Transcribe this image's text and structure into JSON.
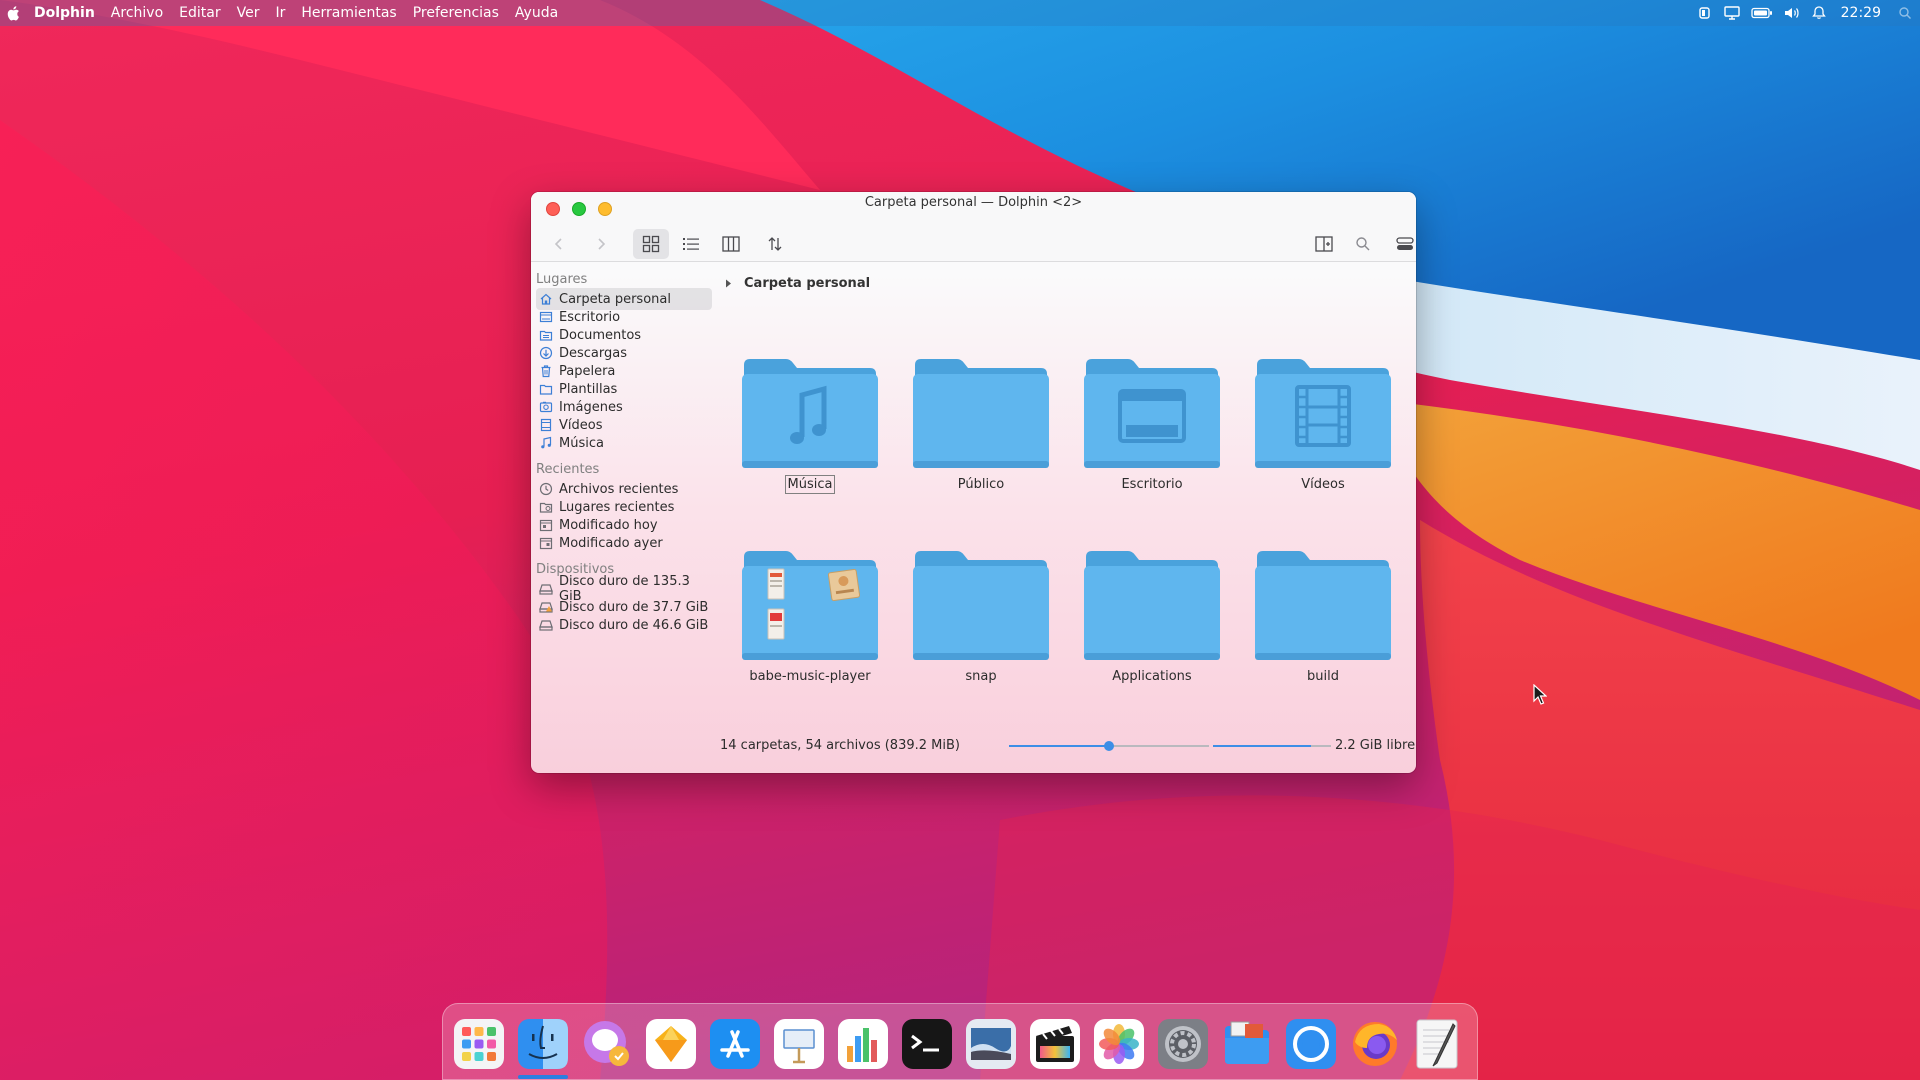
{
  "menubar": {
    "app_name": "Dolphin",
    "items": [
      "Archivo",
      "Editar",
      "Ver",
      "Ir",
      "Herramientas",
      "Preferencias",
      "Ayuda"
    ],
    "tray_icons": [
      "battery-monitor-icon",
      "display-icon",
      "battery-icon",
      "volume-icon",
      "notifications-icon"
    ],
    "clock": "22:29"
  },
  "window": {
    "title": "Carpeta personal — Dolphin <2>",
    "toolbar": {
      "buttons": [
        "back-icon",
        "forward-icon",
        "icons-view-icon",
        "details-view-icon",
        "columns-view-icon",
        "sort-icon",
        "split-view-icon",
        "search-icon",
        "menu-icon"
      ],
      "active_view": "icons"
    },
    "sidebar": {
      "sections": [
        {
          "title": "Lugares",
          "items": [
            {
              "label": "Carpeta personal",
              "icon": "home-icon",
              "selected": true
            },
            {
              "label": "Escritorio",
              "icon": "desktop-icon"
            },
            {
              "label": "Documentos",
              "icon": "documents-icon"
            },
            {
              "label": "Descargas",
              "icon": "downloads-icon"
            },
            {
              "label": "Papelera",
              "icon": "trash-icon"
            },
            {
              "label": "Plantillas",
              "icon": "templates-icon"
            },
            {
              "label": "Imágenes",
              "icon": "pictures-icon"
            },
            {
              "label": "Vídeos",
              "icon": "videos-icon"
            },
            {
              "label": "Música",
              "icon": "music-icon"
            }
          ]
        },
        {
          "title": "Recientes",
          "items": [
            {
              "label": "Archivos recientes",
              "icon": "recent-files-icon"
            },
            {
              "label": "Lugares recientes",
              "icon": "recent-places-icon"
            },
            {
              "label": "Modificado hoy",
              "icon": "calendar-today-icon"
            },
            {
              "label": "Modificado ayer",
              "icon": "calendar-yesterday-icon"
            }
          ]
        },
        {
          "title": "Dispositivos",
          "items": [
            {
              "label": "Disco duro de 135.3 GiB",
              "icon": "hard-disk-icon"
            },
            {
              "label": "Disco duro de 37.7 GiB",
              "icon": "hard-disk-warning-icon"
            },
            {
              "label": "Disco duro de 46.6 GiB",
              "icon": "hard-disk-icon"
            }
          ]
        }
      ]
    },
    "breadcrumb": "Carpeta personal",
    "folders": [
      {
        "name": "Música",
        "emblem": "music-note",
        "focused": true
      },
      {
        "name": "Público",
        "emblem": "none"
      },
      {
        "name": "Escritorio",
        "emblem": "desktop"
      },
      {
        "name": "Vídeos",
        "emblem": "film"
      },
      {
        "name": "babe-music-player",
        "emblem": "file-previews"
      },
      {
        "name": "snap",
        "emblem": "none"
      },
      {
        "name": "Applications",
        "emblem": "none"
      },
      {
        "name": "build",
        "emblem": "none"
      }
    ],
    "status": {
      "summary": "14 carpetas, 54 archivos (839.2 MiB)",
      "zoom_level": 0.5,
      "free_space_text": "2.2 GiB libre",
      "used_fraction": 0.83
    }
  },
  "dock": {
    "apps": [
      {
        "name": "launchpad-icon",
        "running": false
      },
      {
        "name": "dolphin-finder-icon",
        "running": true
      },
      {
        "name": "messenger-icon",
        "running": false
      },
      {
        "name": "sketch-icon",
        "running": false
      },
      {
        "name": "app-store-icon",
        "running": false
      },
      {
        "name": "keynote-icon",
        "running": false
      },
      {
        "name": "numbers-icon",
        "running": false
      },
      {
        "name": "terminal-icon",
        "running": false
      },
      {
        "name": "preview-icon",
        "running": false
      },
      {
        "name": "final-cut-icon",
        "running": false
      },
      {
        "name": "photos-icon",
        "running": false
      },
      {
        "name": "system-preferences-icon",
        "running": false
      },
      {
        "name": "files-icon",
        "running": false
      },
      {
        "name": "browser-icon",
        "running": false
      },
      {
        "name": "firefox-icon",
        "running": false
      },
      {
        "name": "text-editor-icon",
        "running": false
      }
    ]
  },
  "colors": {
    "accent": "#3d8ee6",
    "folder_body": "#5fb6ee",
    "folder_back": "#4aa2dc",
    "close": "#fe5f57",
    "maximize": "#28c840",
    "minimize": "#febc2e"
  }
}
